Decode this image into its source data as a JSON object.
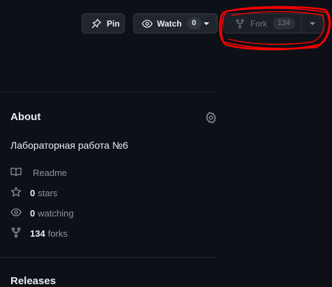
{
  "header": {
    "pin": {
      "label": "Pin",
      "icon": "pin-icon"
    },
    "watch": {
      "label": "Watch",
      "count": "0",
      "icon": "eye-icon"
    },
    "fork": {
      "label": "Fork",
      "count": "134",
      "icon": "repo-forked-icon",
      "disabled": true
    }
  },
  "annotation": {
    "color": "#ff0000",
    "shape": "hand-drawn circle around fork button"
  },
  "about": {
    "heading": "About",
    "description": "Лабораторная работа №6",
    "items": [
      {
        "icon": "book-icon",
        "count": "",
        "label": "Readme"
      },
      {
        "icon": "star-icon",
        "count": "0",
        "label": "stars"
      },
      {
        "icon": "eye-icon",
        "count": "0",
        "label": "watching"
      },
      {
        "icon": "repo-forked-icon",
        "count": "134",
        "label": "forks"
      }
    ]
  },
  "releases": {
    "heading": "Releases"
  },
  "colors": {
    "background": "#0d1117",
    "text": "#e6edf3",
    "muted": "#8b949e",
    "button": "#21262d"
  }
}
